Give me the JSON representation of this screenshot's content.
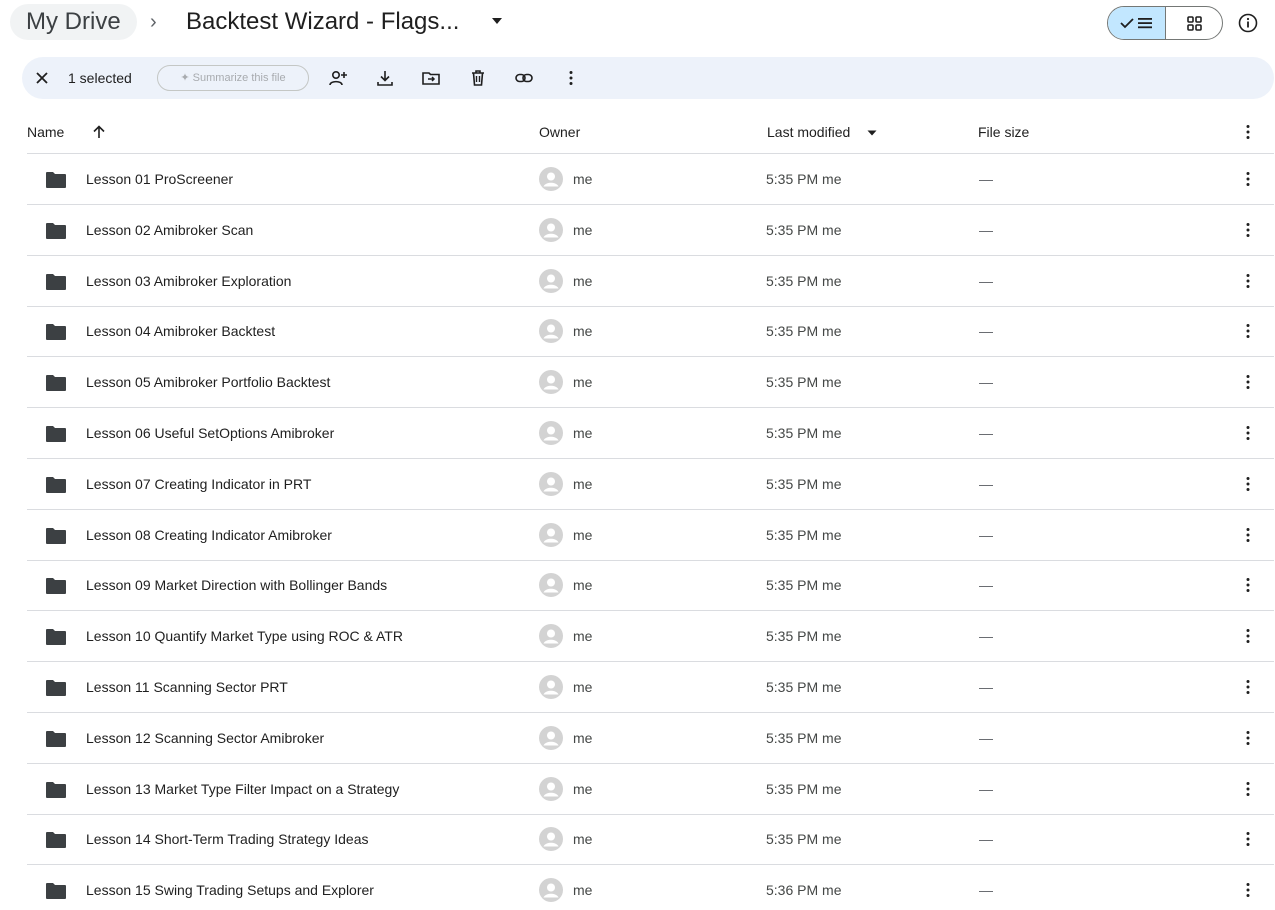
{
  "breadcrumb": {
    "root": "My Drive",
    "separator": "›",
    "current": "Backtest Wizard - Flags..."
  },
  "view": {
    "active": "list"
  },
  "actionbar": {
    "selected_label": "1 selected",
    "summarize_label": "Summarize this file"
  },
  "columns": {
    "name": "Name",
    "owner": "Owner",
    "modified": "Last modified",
    "size": "File size"
  },
  "colors": {
    "accent": "#c2e7ff",
    "actionbar_bg": "#edf2fa",
    "folder": "#3c4043"
  },
  "files": [
    {
      "name": "Lesson 01 ProScreener",
      "owner": "me",
      "modified": "5:35 PM me",
      "size": "—"
    },
    {
      "name": "Lesson 02 Amibroker Scan",
      "owner": "me",
      "modified": "5:35 PM me",
      "size": "—"
    },
    {
      "name": "Lesson 03 Amibroker Exploration",
      "owner": "me",
      "modified": "5:35 PM me",
      "size": "—"
    },
    {
      "name": "Lesson 04 Amibroker Backtest",
      "owner": "me",
      "modified": "5:35 PM me",
      "size": "—"
    },
    {
      "name": "Lesson 05 Amibroker Portfolio Backtest",
      "owner": "me",
      "modified": "5:35 PM me",
      "size": "—"
    },
    {
      "name": "Lesson 06 Useful SetOptions Amibroker",
      "owner": "me",
      "modified": "5:35 PM me",
      "size": "—"
    },
    {
      "name": "Lesson 07 Creating Indicator in PRT",
      "owner": "me",
      "modified": "5:35 PM me",
      "size": "—"
    },
    {
      "name": "Lesson 08 Creating Indicator Amibroker",
      "owner": "me",
      "modified": "5:35 PM me",
      "size": "—"
    },
    {
      "name": "Lesson 09 Market Direction with Bollinger Bands",
      "owner": "me",
      "modified": "5:35 PM me",
      "size": "—"
    },
    {
      "name": "Lesson 10 Quantify Market Type using ROC & ATR",
      "owner": "me",
      "modified": "5:35 PM me",
      "size": "—"
    },
    {
      "name": "Lesson 11 Scanning Sector PRT",
      "owner": "me",
      "modified": "5:35 PM me",
      "size": "—"
    },
    {
      "name": "Lesson 12 Scanning Sector Amibroker",
      "owner": "me",
      "modified": "5:35 PM me",
      "size": "—"
    },
    {
      "name": "Lesson 13 Market Type Filter Impact on a Strategy",
      "owner": "me",
      "modified": "5:35 PM me",
      "size": "—"
    },
    {
      "name": "Lesson 14 Short-Term Trading Strategy Ideas",
      "owner": "me",
      "modified": "5:35 PM me",
      "size": "—"
    },
    {
      "name": "Lesson 15 Swing Trading Setups and Explorer",
      "owner": "me",
      "modified": "5:36 PM me",
      "size": "—"
    }
  ]
}
